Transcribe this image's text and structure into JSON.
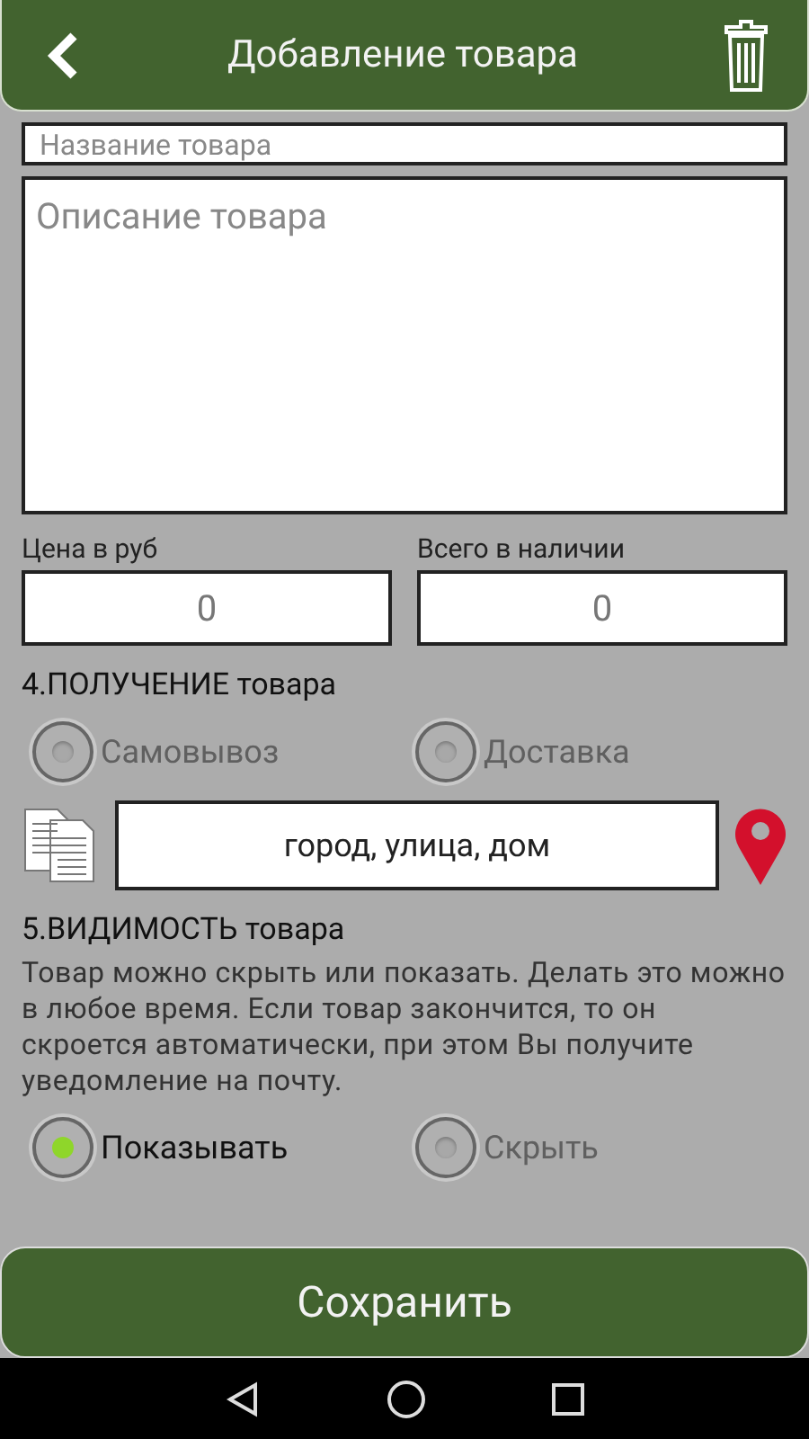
{
  "header": {
    "title": "Добавление товара"
  },
  "name_field": {
    "placeholder": "Название товара"
  },
  "description_field": {
    "placeholder": "Описание товара"
  },
  "price": {
    "label": "Цена в руб",
    "value": "0"
  },
  "stock": {
    "label": "Всего в наличии",
    "value": "0"
  },
  "delivery": {
    "heading": "4.ПОЛУЧЕНИЕ товара",
    "options": [
      {
        "label": "Самовывоз",
        "selected": false
      },
      {
        "label": "Доставка",
        "selected": false
      }
    ],
    "address_placeholder": "город, улица, дом"
  },
  "visibility": {
    "heading": "5.ВИДИМОСТЬ товара",
    "description": "Товар можно скрыть или показать. Делать это можно в любое время. Если товар закончится, то он скроется автоматически, при этом Вы получите уведомление на почту.",
    "options": [
      {
        "label": "Показывать",
        "selected": true
      },
      {
        "label": "Скрыть",
        "selected": false
      }
    ]
  },
  "save_button": "Сохранить"
}
